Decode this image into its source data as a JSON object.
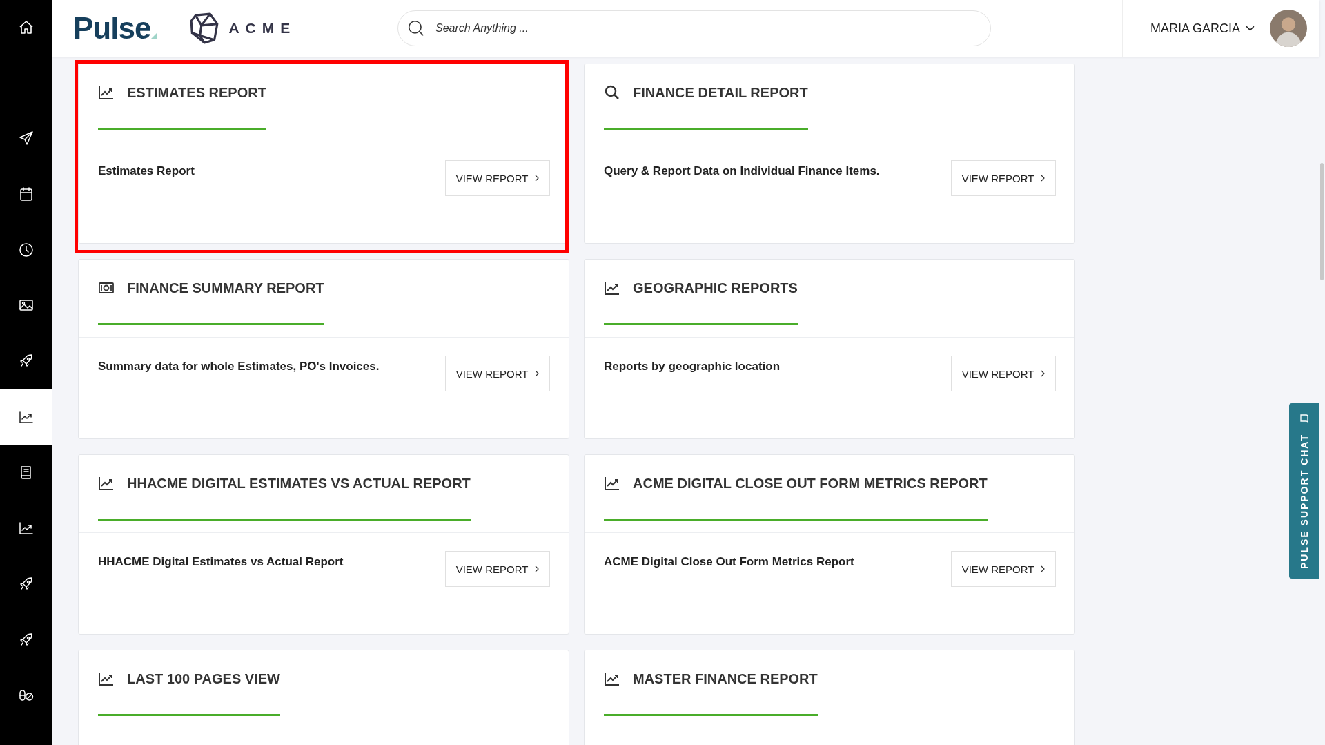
{
  "header": {
    "logo": "Pulse",
    "brand": "ACME",
    "search": {
      "placeholder": "Search Anything ..."
    },
    "user": "MARIA GARCIA"
  },
  "sidebar": {
    "items": [
      {
        "kind": "send",
        "selected": false
      },
      {
        "kind": "calendar",
        "selected": false
      },
      {
        "kind": "clock",
        "selected": false
      },
      {
        "kind": "image",
        "selected": false
      },
      {
        "kind": "rocket",
        "selected": false
      },
      {
        "kind": "chart",
        "selected": true
      },
      {
        "kind": "book",
        "selected": false
      },
      {
        "kind": "chart",
        "selected": false
      },
      {
        "kind": "rocket",
        "selected": false
      },
      {
        "kind": "rocket",
        "selected": false
      },
      {
        "kind": "pills",
        "selected": false
      }
    ]
  },
  "reports": [
    {
      "kind": "chart",
      "title": "ESTIMATES REPORT",
      "description": "Estimates Report",
      "button": "VIEW REPORT",
      "highlighted": true
    },
    {
      "kind": "search",
      "title": "FINANCE DETAIL REPORT",
      "description": "Query & Report Data on Individual Finance Items.",
      "button": "VIEW REPORT",
      "highlighted": false
    },
    {
      "kind": "money",
      "title": "FINANCE SUMMARY REPORT",
      "description": "Summary data for whole Estimates, PO's Invoices.",
      "button": "VIEW REPORT",
      "highlighted": false
    },
    {
      "kind": "chart",
      "title": "GEOGRAPHIC REPORTS",
      "description": "Reports by geographic location",
      "button": "VIEW REPORT",
      "highlighted": false
    },
    {
      "kind": "chart",
      "title": "HHACME DIGITAL ESTIMATES VS ACTUAL REPORT",
      "description": "HHACME Digital Estimates vs Actual Report",
      "button": "VIEW REPORT",
      "highlighted": false
    },
    {
      "kind": "chart",
      "title": "ACME DIGITAL CLOSE OUT FORM METRICS REPORT",
      "description": "ACME Digital Close Out Form Metrics Report",
      "button": "VIEW REPORT",
      "highlighted": false
    },
    {
      "kind": "chart",
      "title": "LAST 100 PAGES VIEW",
      "highlighted": false
    },
    {
      "kind": "chart",
      "title": "MASTER FINANCE REPORT",
      "highlighted": false
    }
  ],
  "support_chat": {
    "label": "PULSE SUPPORT CHAT"
  }
}
